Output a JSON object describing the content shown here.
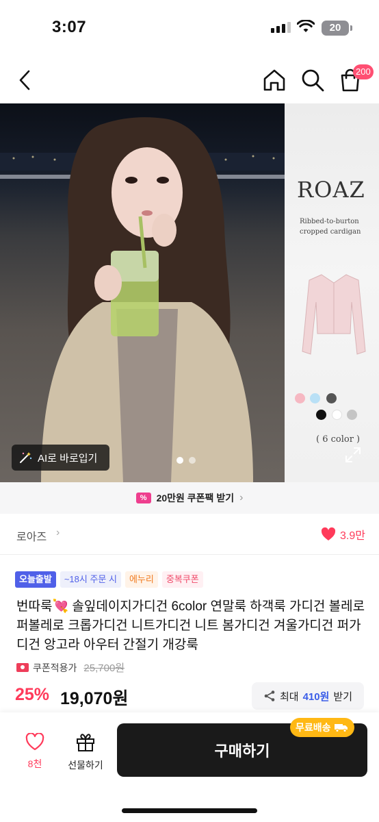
{
  "status": {
    "time": "3:07",
    "battery": "20"
  },
  "nav": {
    "cart_badge": "200"
  },
  "hero": {
    "brand": "ROAZ",
    "subtitle_line1": "Ribbed-to-burton",
    "subtitle_line2": "cropped cardigan",
    "color_count": "( 6 color )",
    "ai_label": "AI로 바로입기",
    "swatches": [
      "#f6b8c2",
      "#b9e0f6",
      "#555555",
      "#111111",
      "#ffffff",
      "#c5c5c5"
    ],
    "slide_total": 2,
    "slide_active": 1
  },
  "coupon_banner": {
    "label": "20만원 쿠폰팩 받기"
  },
  "store": {
    "name": "로아즈",
    "likes": "3.9만"
  },
  "tags": [
    "오늘출발",
    "~18시 주문 시",
    "에누리",
    "중복쿠폰"
  ],
  "product": {
    "title": "번따룩💘 솔잎데이지가디건 6color 연말룩 하객룩 가디건 볼레로 퍼볼레로 크롭가디건 니트가디건 니트 봄가디건 겨울가디건 퍼가디건 앙고라 아우터 간절기 개강룩"
  },
  "price": {
    "coupon_applied_label": "쿠폰적용가",
    "original": "25,700원",
    "discount": "25%",
    "sale": "19,070원",
    "max_coupon_prefix": "최대",
    "max_coupon_amount": "410원",
    "max_coupon_suffix": "받기"
  },
  "bottom": {
    "like_count": "8천",
    "gift_label": "선물하기",
    "buy_label": "구매하기",
    "free_shipping": "무료배송"
  },
  "colors": {
    "accent_pink": "#ff3a5a",
    "tag_blue": "#5060e8",
    "free_ship": "#ffb814",
    "buy_button": "#1a1a1a"
  }
}
